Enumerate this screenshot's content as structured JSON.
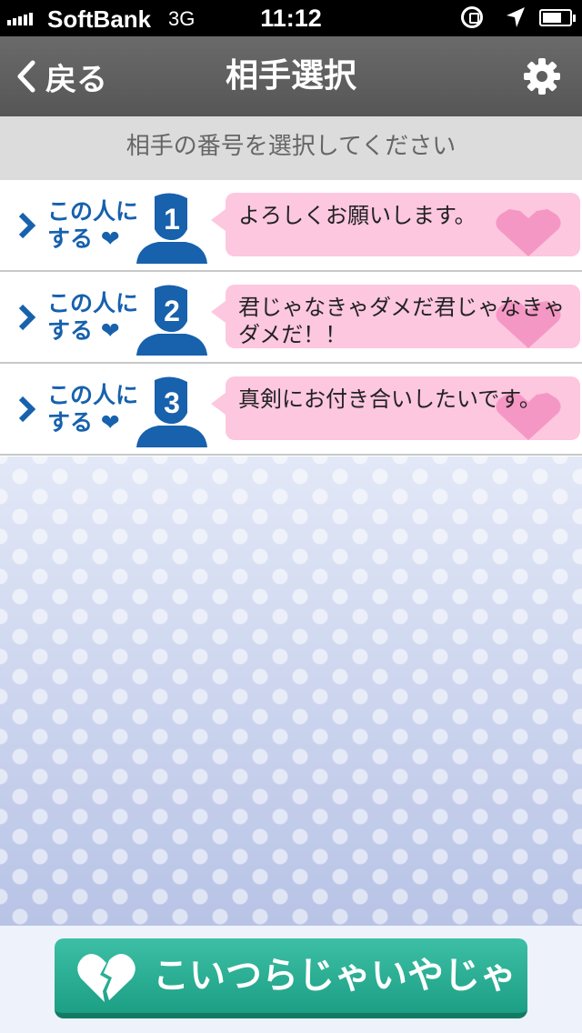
{
  "status_bar": {
    "carrier": "SoftBank",
    "network": "3G",
    "time": "11:12",
    "battery_level": 0.7
  },
  "navbar": {
    "back_label": "戻る",
    "title": "相手選択"
  },
  "instruction": "相手の番号を選択してください",
  "rows": [
    {
      "action_line1": "この人に",
      "action_line2": "する",
      "number": "1",
      "message": "よろしくお願いします。"
    },
    {
      "action_line1": "この人に",
      "action_line2": "する",
      "number": "2",
      "message": "君じゃなきゃダメだ君じゃなきゃダメだ！！"
    },
    {
      "action_line1": "この人に",
      "action_line2": "する",
      "number": "3",
      "message": "真剣にお付き合いしたいです。"
    }
  ],
  "reject_button": {
    "label": "こいつらじゃいやじゃ"
  },
  "colors": {
    "accent_blue": "#1761ad",
    "bubble_pink": "#fcc7df",
    "button_green": "#2bb094"
  },
  "icons": {
    "back": "chevron-left-icon",
    "settings": "gear-icon",
    "choose": "chevron-right-icon",
    "heart": "heart-icon",
    "avatar": "person-silhouette-icon",
    "reject": "broken-heart-icon"
  }
}
